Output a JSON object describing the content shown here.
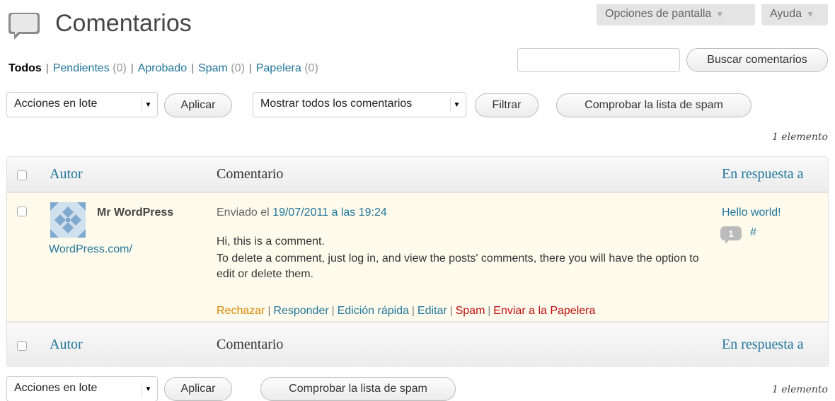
{
  "header": {
    "title": "Comentarios",
    "screen_options_label": "Opciones de pantalla",
    "help_label": "Ayuda"
  },
  "status_links": {
    "all": "Todos",
    "pending": "Pendientes",
    "pending_count": "(0)",
    "approved": "Aprobado",
    "spam": "Spam",
    "spam_count": "(0)",
    "trash": "Papelera",
    "trash_count": "(0)"
  },
  "search": {
    "value": "",
    "button_label": "Buscar comentarios"
  },
  "top_nav": {
    "bulk_select": "Acciones en lote",
    "apply_label": "Aplicar",
    "filter_select": "Mostrar todos los comentarios",
    "filter_label": "Filtrar",
    "check_spam_label": "Comprobar la lista de spam",
    "item_count": "1 elemento"
  },
  "table": {
    "columns": [
      "Autor",
      "Comentario",
      "En respuesta a"
    ],
    "rows": [
      {
        "author_name": "Mr WordPress",
        "author_url": "WordPress.com/",
        "submitted_prefix": "Enviado el",
        "submitted_date": "19/07/2011 a las 19:24",
        "body_line1": "Hi, this is a comment.",
        "body_line2": "To delete a comment, just log in, and view the posts' comments, there you will have the option to edit or delete them.",
        "actions": {
          "unapprove": "Rechazar",
          "reply": "Responder",
          "quick_edit": "Edición rápida",
          "edit": "Editar",
          "spam": "Spam",
          "trash": "Enviar a la Papelera"
        },
        "response_post": "Hello world!",
        "comment_count": "1",
        "permalink": "#"
      }
    ]
  },
  "bottom_nav": {
    "bulk_select": "Acciones en lote",
    "apply_label": "Aplicar",
    "check_spam_label": "Comprobar la lista de spam",
    "item_count": "1 elemento"
  },
  "colors": {
    "link": "#21759b",
    "unapprove": "#d98500",
    "danger": "#bc0b0b",
    "row_highlight": "#fffbec"
  }
}
